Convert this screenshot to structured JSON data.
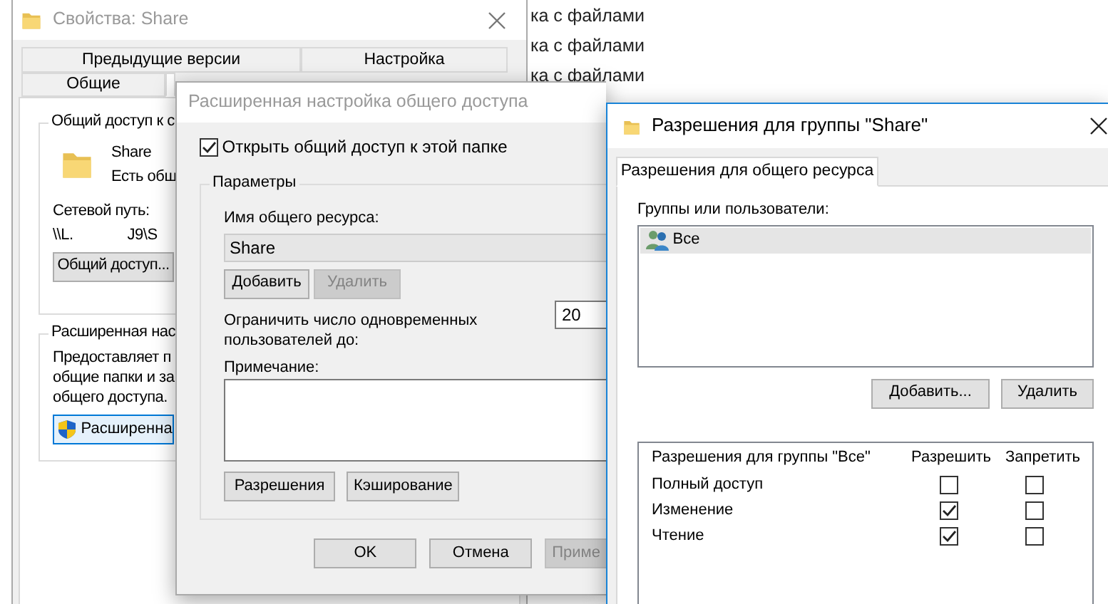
{
  "background_list": {
    "items": [
      "ка с файлами",
      "ка с файлами",
      "ка с файлами"
    ]
  },
  "properties_window": {
    "title": "Свойства: Share",
    "tabs_row_1": [
      {
        "label": "Предыдущие версии",
        "selected": false
      },
      {
        "label": "Настройка",
        "selected": false
      }
    ],
    "tabs_row_2": [
      {
        "label": "Общие",
        "selected": false
      },
      {
        "selected": true
      }
    ],
    "sharing_group": {
      "title": "Общий доступ к с",
      "name": "Share",
      "status": "Есть общ",
      "path_label": "Сетевой путь:",
      "path_parts": [
        "\\\\L.",
        "J9\\S"
      ],
      "button": "Общий доступ..."
    },
    "advanced_group": {
      "title": "Расширенная нас",
      "description": [
        "Предоставляет п",
        "общие папки и за",
        "общего доступа."
      ],
      "button": "Расширенна"
    }
  },
  "advanced_window": {
    "title": "Расширенная настройка общего доступа",
    "share_checkbox": {
      "label": "Открыть общий доступ к этой папке",
      "checked": true
    },
    "group_title": "Параметры",
    "share_name_label": "Имя общего ресурса:",
    "share_name": "Share",
    "name_buttons": [
      {
        "label": "Добавить",
        "disabled": false
      },
      {
        "label": "Удалить",
        "disabled": true
      }
    ],
    "limit_label": "Ограничить число одновременных пользователей до:",
    "limit_value": "20",
    "comment_label": "Примечание:",
    "group_buttons": [
      {
        "label": "Разрешения",
        "disabled": false
      },
      {
        "label": "Кэширование",
        "disabled": false
      }
    ],
    "footer_buttons": [
      {
        "label": "OK",
        "disabled": false
      },
      {
        "label": "Отмена",
        "disabled": false
      },
      {
        "label": "Приме",
        "disabled": true
      }
    ]
  },
  "permissions_window": {
    "title": "Разрешения для группы \"Share\"",
    "tab": {
      "label": "Разрешения для общего ресурса",
      "selected": true
    },
    "users_label": "Группы или пользователи:",
    "users": [
      {
        "name": "Все",
        "selected": true
      }
    ],
    "user_buttons": [
      "Добавить...",
      "Удалить"
    ],
    "permissions_header": "Разрешения для группы \"Все\"",
    "columns": [
      "Разрешить",
      "Запретить"
    ],
    "permissions": [
      {
        "name": "Полный доступ",
        "allow": false,
        "deny": false
      },
      {
        "name": "Изменение",
        "allow": true,
        "deny": false
      },
      {
        "name": "Чтение",
        "allow": true,
        "deny": false
      }
    ]
  }
}
